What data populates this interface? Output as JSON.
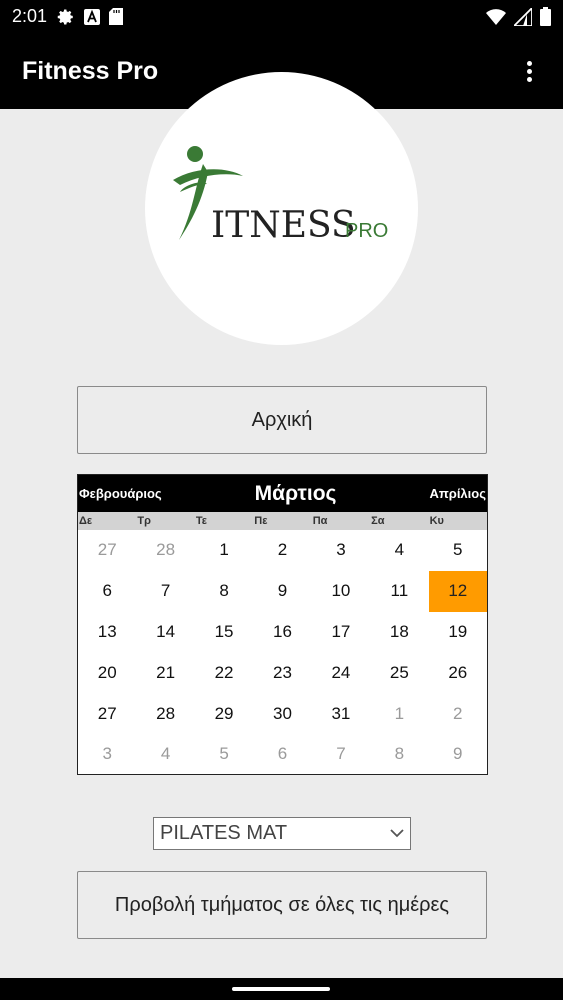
{
  "status_bar": {
    "time": "2:01",
    "icons_left": [
      "gear-icon",
      "font-icon",
      "sdcard-icon"
    ],
    "icons_right": [
      "wifi-icon",
      "signal-icon",
      "battery-icon"
    ]
  },
  "app_bar": {
    "title": "Fitness Pro",
    "menu_icon": "overflow-menu-icon"
  },
  "logo": {
    "text_main": "ITNESS",
    "text_small": "PRO",
    "brand_color": "#3a7a35"
  },
  "home_button": {
    "label": "Αρχική"
  },
  "calendar": {
    "prev_month": "Φεβρουάριος",
    "month": "Μάρτιος",
    "next_month": "Απρίλιος",
    "weekdays": [
      "Δε",
      "Τρ",
      "Τε",
      "Πε",
      "Πα",
      "Σα",
      "Κυ"
    ],
    "days": [
      {
        "d": "27",
        "other": true
      },
      {
        "d": "28",
        "other": true
      },
      {
        "d": "1"
      },
      {
        "d": "2"
      },
      {
        "d": "3"
      },
      {
        "d": "4"
      },
      {
        "d": "5"
      },
      {
        "d": "6"
      },
      {
        "d": "7"
      },
      {
        "d": "8"
      },
      {
        "d": "9"
      },
      {
        "d": "10"
      },
      {
        "d": "11"
      },
      {
        "d": "12",
        "today": true
      },
      {
        "d": "13"
      },
      {
        "d": "14"
      },
      {
        "d": "15"
      },
      {
        "d": "16"
      },
      {
        "d": "17"
      },
      {
        "d": "18"
      },
      {
        "d": "19"
      },
      {
        "d": "20"
      },
      {
        "d": "21"
      },
      {
        "d": "22"
      },
      {
        "d": "23"
      },
      {
        "d": "24"
      },
      {
        "d": "25"
      },
      {
        "d": "26"
      },
      {
        "d": "27"
      },
      {
        "d": "28"
      },
      {
        "d": "29"
      },
      {
        "d": "30"
      },
      {
        "d": "31"
      },
      {
        "d": "1",
        "other": true
      },
      {
        "d": "2",
        "other": true
      },
      {
        "d": "3",
        "other": true
      },
      {
        "d": "4",
        "other": true
      },
      {
        "d": "5",
        "other": true
      },
      {
        "d": "6",
        "other": true
      },
      {
        "d": "7",
        "other": true
      },
      {
        "d": "8",
        "other": true
      },
      {
        "d": "9",
        "other": true
      }
    ],
    "highlight_color": "#ff9b00"
  },
  "class_select": {
    "value": "PILATES MAT"
  },
  "view_button": {
    "label": "Προβολή τμήματος σε όλες τις ημέρες"
  }
}
